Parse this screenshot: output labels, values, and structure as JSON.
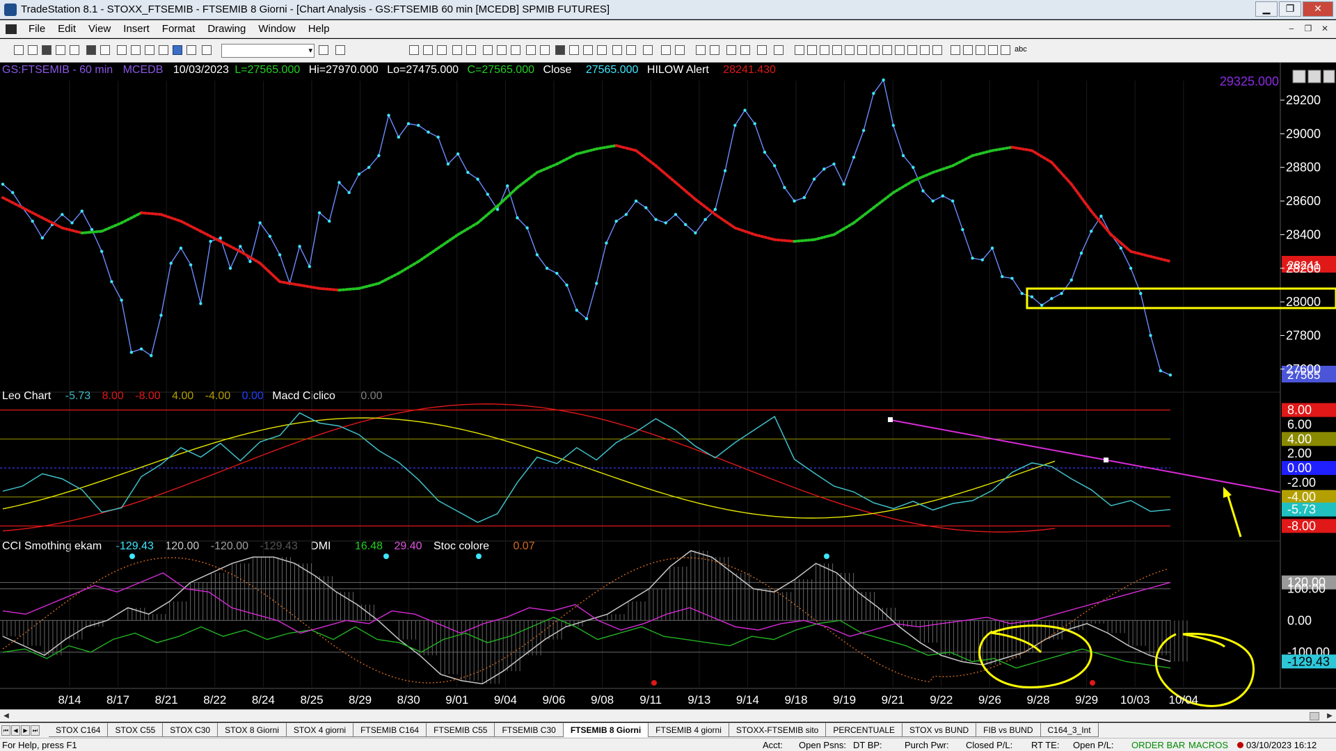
{
  "window": {
    "title": "TradeStation 8.1 - STOXX_FTSEMIB - FTSEMIB  8 Giorni - [Chart Analysis - GS:FTSEMIB  60 min  [MCEDB] SPMIB FUTURES]",
    "minimize": "▁",
    "restore": "❐",
    "close": "✕"
  },
  "menu": {
    "items": [
      "File",
      "Edit",
      "View",
      "Insert",
      "Format",
      "Drawing",
      "Window",
      "Help"
    ],
    "mdi_min": "‒",
    "mdi_restore": "❐",
    "mdi_close": "✕"
  },
  "toolbar": {
    "combo_arrow": "▾",
    "abc_label": "abc"
  },
  "header": {
    "symbol": "GS:FTSEMIB - 60 min",
    "datafeed": "MCEDB",
    "date": "10/03/2023",
    "last": "L=27565.000",
    "high": "Hi=27970.000",
    "low": "Lo=27475.000",
    "close": "C=27565.000",
    "close_label": "Close",
    "close_value": "27565.000",
    "alert_label": "HILOW Alert",
    "alert_value": "28241.430",
    "top_value": "29325.000"
  },
  "pane2_header": {
    "name": "Leo Chart",
    "v1": "-5.73",
    "v2": "8.00",
    "v3": "-8.00",
    "v4": "4.00",
    "v5": "-4.00",
    "v6": "0.00",
    "name2": "Macd Ciclico",
    "v7": "0.00"
  },
  "pane3_header": {
    "name": "CCI Smothing ekam",
    "v1": "-129.43",
    "v2": "120.00",
    "v3": "-120.00",
    "v4": "-129.43",
    "name2": "DMI",
    "v5": "16.48",
    "v6": "29.40",
    "name3": "Stoc colore",
    "v7": "0.07"
  },
  "axis": {
    "price_ticks": [
      "29200",
      "29000",
      "28800",
      "28600",
      "28400",
      "28200",
      "28000",
      "27800",
      "27600"
    ],
    "price_badges": {
      "hilow": "28241",
      "last": "27565"
    },
    "osc_ticks": [
      "8.00",
      "6.00",
      "4.00",
      "2.00",
      "0.00",
      "-2.00",
      "-4.00",
      "-5.73",
      "-8.00"
    ],
    "cci_ticks": [
      "120.00",
      "100.00",
      "0.00",
      "-100.00",
      "-129.43"
    ],
    "dates": [
      "8/14",
      "8/17",
      "8/21",
      "8/22",
      "8/24",
      "8/25",
      "8/29",
      "8/30",
      "9/01",
      "9/04",
      "9/06",
      "9/08",
      "9/11",
      "9/13",
      "9/14",
      "9/18",
      "9/19",
      "9/21",
      "9/22",
      "9/26",
      "9/28",
      "9/29",
      "10/03",
      "10/04"
    ]
  },
  "chart_data": [
    {
      "type": "line",
      "title": "",
      "series": [
        {
          "name": "Close",
          "values": [
            28700,
            28650,
            28560,
            28480,
            28380,
            28460,
            28520,
            28470,
            28540,
            28430,
            28300,
            28120,
            28010,
            27700,
            27720,
            27680,
            27920,
            28230,
            28320,
            28220,
            27990,
            28360,
            28380,
            28200,
            28330,
            28240,
            28470,
            28390,
            28280,
            28110,
            28330,
            28210,
            28530,
            28480,
            28710,
            28650,
            28760,
            28800,
            28870,
            29110,
            28980,
            29060,
            29050,
            29010,
            28980,
            28820,
            28880,
            28770,
            28730,
            28640,
            28550,
            28690,
            28500,
            28440,
            28280,
            28200,
            28170,
            28100,
            27950,
            27900,
            28110,
            28350,
            28480,
            28520,
            28600,
            28560,
            28490,
            28470,
            28520,
            28460,
            28410,
            28490,
            28550,
            28780,
            29050,
            29140,
            29060,
            28890,
            28810,
            28680,
            28600,
            28620,
            28730,
            28790,
            28820,
            28700,
            28860,
            29020,
            29240,
            29320,
            29050,
            28870,
            28800,
            28660,
            28600,
            28630,
            28600,
            28430,
            28260,
            28250,
            28320,
            28150,
            28140,
            28050,
            28030,
            27980,
            28020,
            28050,
            28130,
            28290,
            28420,
            28510,
            28400,
            28320,
            28200,
            28050,
            27800,
            27590,
            27565
          ]
        },
        {
          "name": "HILOW Alert",
          "values": [
            28620,
            28560,
            28500,
            28440,
            28410,
            28420,
            28470,
            28530,
            28520,
            28480,
            28420,
            28360,
            28300,
            28230,
            28120,
            28100,
            28080,
            28070,
            28080,
            28110,
            28170,
            28240,
            28320,
            28400,
            28470,
            28570,
            28680,
            28770,
            28820,
            28880,
            28910,
            28930,
            28900,
            28810,
            28710,
            28610,
            28520,
            28440,
            28400,
            28370,
            28360,
            28370,
            28400,
            28470,
            28560,
            28650,
            28720,
            28770,
            28810,
            28870,
            28900,
            28920,
            28900,
            28830,
            28700,
            28540,
            28400,
            28300,
            28270,
            28241
          ]
        }
      ],
      "ylim": [
        27500,
        29320
      ]
    },
    {
      "type": "line",
      "title": "",
      "series": [
        {
          "name": "Leo Chart",
          "values": [
            -3.2,
            -2.5,
            -0.8,
            -1.5,
            -3.0,
            -6.1,
            -5.5,
            -1.2,
            0.5,
            2.8,
            1.5,
            3.4,
            1.0,
            3.6,
            4.5,
            7.6,
            6.2,
            5.8,
            4.6,
            2.4,
            0.8,
            -1.6,
            -4.5,
            -6.0,
            -7.5,
            -6.3,
            -2.0,
            1.5,
            0.6,
            2.8,
            1.1,
            3.5,
            5.0,
            6.8,
            5.2,
            3.0,
            1.4,
            3.5,
            5.3,
            7.1,
            1.2,
            -0.7,
            -2.5,
            -3.3,
            -4.8,
            -5.6,
            -4.6,
            -5.8,
            -4.9,
            -4.5,
            -3.1,
            -0.6,
            0.7,
            0.2,
            -1.5,
            -3.0,
            -5.2,
            -4.5,
            -6.0,
            -5.73
          ]
        },
        {
          "name": "8.00",
          "values": [
            8.0,
            8.0
          ]
        },
        {
          "name": "-8.00",
          "values": [
            -8.0,
            -8.0
          ]
        },
        {
          "name": "4.00",
          "values": [
            4.0,
            4.0
          ]
        },
        {
          "name": "-4.00",
          "values": [
            -4.0,
            -4.0
          ]
        },
        {
          "name": "0.00",
          "values": [
            0.0,
            0.0
          ]
        }
      ],
      "ylim": [
        -9.5,
        9.5
      ]
    },
    {
      "type": "line",
      "title": "",
      "series": [
        {
          "name": "CCI Smothing ekam",
          "values": [
            -50,
            -80,
            -110,
            -60,
            -20,
            0,
            40,
            20,
            60,
            120,
            150,
            180,
            200,
            200,
            180,
            140,
            90,
            50,
            0,
            -60,
            -110,
            -170,
            -190,
            -200,
            -160,
            -110,
            -60,
            -20,
            0,
            20,
            60,
            100,
            170,
            220,
            200,
            150,
            100,
            90,
            130,
            180,
            150,
            90,
            40,
            -20,
            -70,
            -110,
            -130,
            -140,
            -120,
            -100,
            -60,
            -30,
            -10,
            -40,
            -80,
            -110,
            -129.43
          ]
        },
        {
          "name": "16.48",
          "values": [
            -100,
            -90,
            -120,
            -80,
            -100,
            -60,
            -40,
            -70,
            -50,
            -20,
            -50,
            -30,
            -60,
            -40,
            -30,
            -60,
            -20,
            -60,
            -70,
            -100,
            -60,
            -40,
            -70,
            -50,
            -20,
            10,
            -20,
            -60,
            -40,
            -20,
            -50,
            -60,
            -70,
            -80,
            -50,
            -60,
            -30,
            -10,
            0,
            -40,
            -60,
            -80,
            -110,
            -100,
            -130,
            -120,
            -150,
            -130,
            -110,
            -90,
            -110,
            -130,
            -140,
            -150
          ]
        },
        {
          "name": "29.40",
          "values": [
            30,
            20,
            50,
            80,
            110,
            90,
            120,
            150,
            100,
            90,
            40,
            20,
            0,
            -40,
            -20,
            0,
            -10,
            30,
            20,
            -10,
            -40,
            -10,
            10,
            40,
            30,
            50,
            0,
            -30,
            -10,
            20,
            40,
            10,
            -20,
            -30,
            -10,
            0,
            -20,
            -50,
            -30,
            -10,
            -20,
            -10,
            0,
            10,
            -10,
            0,
            20,
            40,
            60,
            80,
            100,
            120
          ]
        }
      ],
      "ylim": [
        -210,
        220
      ]
    }
  ],
  "tabs": {
    "nav": [
      "⏮",
      "◀",
      "▶",
      "⏭"
    ],
    "items": [
      "STOX C164",
      "STOX C55",
      "STOX  C30",
      "STOX  8 Giorni",
      "STOX 4 giorni",
      "FTSEMIB C164",
      "FTSEMIB C55",
      "FTSEMIB C30",
      "FTSEMIB  8 Giorni",
      "FTSEMIB  4 giorni",
      "STOXX-FTSEMIB sito",
      "PERCENTUALE",
      "STOX vs BUND",
      "FIB vs BUND",
      "C164_3_Int"
    ],
    "active_index": 8
  },
  "status": {
    "help": "For Help, press F1",
    "acct": "Acct:",
    "open_psns": "Open Psns:",
    "dt_bp": "DT BP:",
    "purch_pwr": "Purch Pwr:",
    "closed_pl": "Closed P/L:",
    "rt_te": "RT TE:",
    "open_pl": "Open P/L:",
    "order_bar": "ORDER BAR",
    "macros": "MACROS",
    "datetime": "03/10/2023 16:12"
  },
  "colors": {
    "price": "#6b8cff",
    "price_dots": "#3ee6ff",
    "hilow_up": "#21c321",
    "hilow_down": "#e01818",
    "osc": "#3fc1c9",
    "red_line": "#e01818",
    "yellow": "#e6e600",
    "magenta": "#d82bd8",
    "green": "#22b422",
    "white_line": "#c8c8c8"
  }
}
